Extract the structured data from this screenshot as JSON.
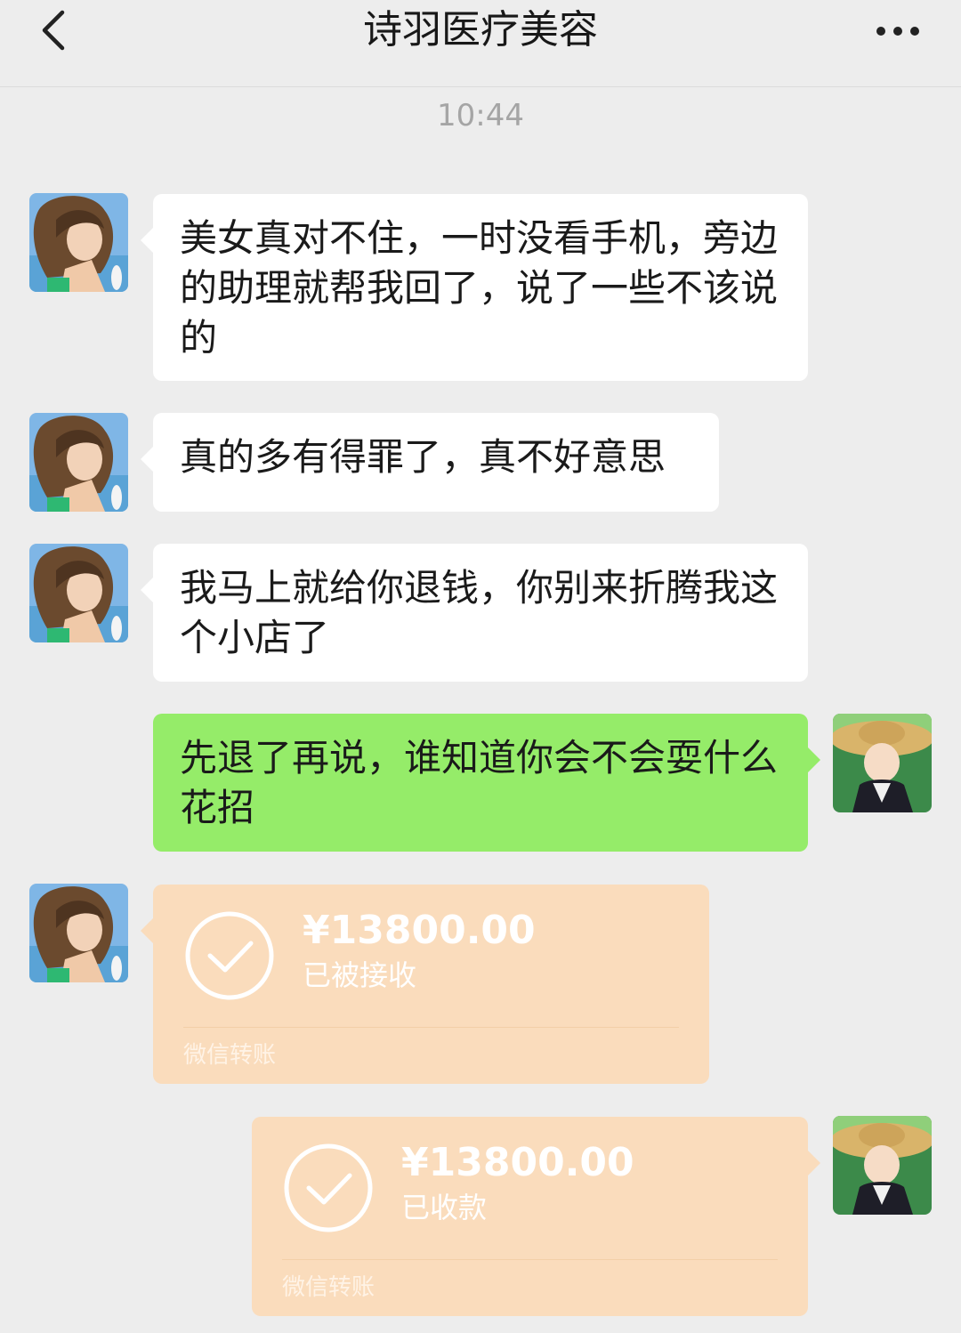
{
  "header": {
    "title": "诗羽医疗美容",
    "back_icon": "chevron-left-icon",
    "more_icon": "more-dots-icon"
  },
  "timestamp": "10:44",
  "messages": [
    {
      "sender": "shop",
      "text": "美女真对不住，一时没看手机，旁边的助理就帮我回了，说了一些不该说的"
    },
    {
      "sender": "shop",
      "text": "真的多有得罪了，真不好意思"
    },
    {
      "sender": "shop",
      "text": "我马上就给你退钱，你别来折腾我这个小店了"
    },
    {
      "sender": "me",
      "text": "先退了再说，谁知道你会不会耍什么花招"
    }
  ],
  "transfers": [
    {
      "sender": "shop",
      "amount": "¥13800.00",
      "status": "已被接收",
      "footer": "微信转账"
    },
    {
      "sender": "me",
      "amount": "¥13800.00",
      "status": "已收款",
      "footer": "微信转账"
    }
  ],
  "colors": {
    "background": "#ededed",
    "incoming_bubble": "#ffffff",
    "outgoing_bubble": "#95ec69",
    "transfer_card": "#fadcbc"
  }
}
